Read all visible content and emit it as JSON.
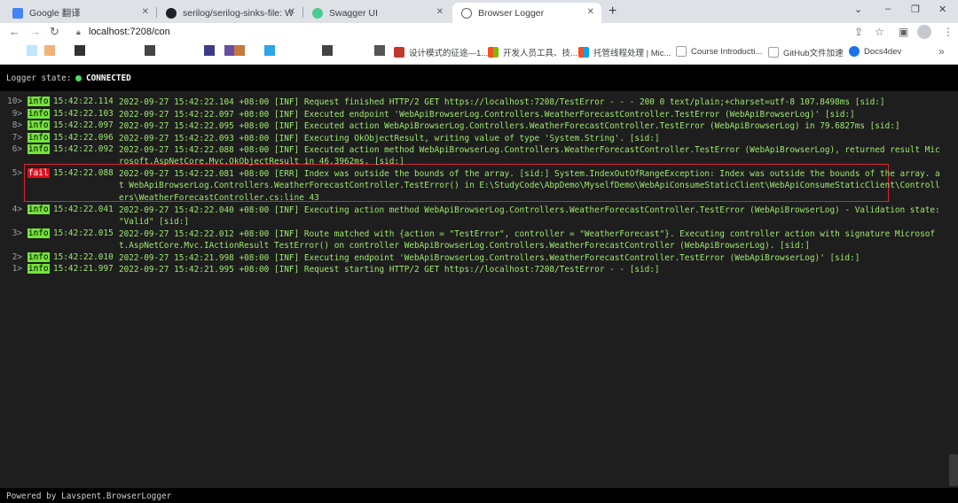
{
  "browser": {
    "tabs": [
      {
        "title": "Google 翻译",
        "icon": "google-translate-icon",
        "color": "#4285f4"
      },
      {
        "title": "serilog/serilog-sinks-file: Writ",
        "icon": "github-icon",
        "color": "#1f2328"
      },
      {
        "title": "Swagger UI",
        "icon": "swagger-icon",
        "color": "#49cc90"
      },
      {
        "title": "Browser Logger",
        "icon": "globe-icon",
        "color": "#5f6368"
      }
    ],
    "new_tab": "+",
    "window_controls": {
      "minimize": "–",
      "restore": "❐",
      "close": "✕",
      "chevron": "⌄"
    },
    "url": "localhost:7208/con",
    "bookmarks": [
      {
        "label": "设计模式的征途—1...",
        "color": "#c0392b"
      },
      {
        "label": "开发人员工具、技...",
        "color": "#f25022"
      },
      {
        "label": "托管线程处理 | Mic...",
        "color": "#f25022"
      },
      {
        "label": "Course Introducti...",
        "color": "#9aa0a6"
      },
      {
        "label": "GitHub文件加速",
        "color": "#9aa0a6"
      },
      {
        "label": "Docs4dev",
        "color": "#1a73e8"
      }
    ]
  },
  "logger": {
    "state_label": "Logger state:",
    "state_value": "CONNECTED",
    "state_color": "#4cd964",
    "entries": [
      {
        "num": "10>",
        "level": "info",
        "time": "15:42:22.114",
        "message": "2022-09-27 15:42:22.104 +08:00 [INF] Request finished HTTP/2 GET https://localhost:7208/TestError - - - 200 0 text/plain;+charset=utf-8 107.8498ms [sid:]"
      },
      {
        "num": "9>",
        "level": "info",
        "time": "15:42:22.103",
        "message": "2022-09-27 15:42:22.097 +08:00 [INF] Executed endpoint 'WebApiBrowserLog.Controllers.WeatherForecastController.TestError (WebApiBrowserLog)' [sid:]"
      },
      {
        "num": "8>",
        "level": "info",
        "time": "15:42:22.097",
        "message": "2022-09-27 15:42:22.095 +08:00 [INF] Executed action WebApiBrowserLog.Controllers.WeatherForecastController.TestError (WebApiBrowserLog) in 79.6827ms [sid:]"
      },
      {
        "num": "7>",
        "level": "info",
        "time": "15:42:22.096",
        "message": "2022-09-27 15:42:22.093 +08:00 [INF] Executing OkObjectResult, writing value of type 'System.String'. [sid:]"
      },
      {
        "num": "6>",
        "level": "info",
        "time": "15:42:22.092",
        "message": "2022-09-27 15:42:22.088 +08:00 [INF] Executed action method WebApiBrowserLog.Controllers.WeatherForecastController.TestError (WebApiBrowserLog), returned result Microsoft.AspNetCore.Mvc.OkObjectResult in 46.3962ms. [sid:]"
      },
      {
        "num": "5>",
        "level": "fail",
        "time": "15:42:22.088",
        "message": "2022-09-27 15:42:22.081 +08:00 [ERR] Index was outside the bounds of the array. [sid:] System.IndexOutOfRangeException: Index was outside the bounds of the array. at WebApiBrowserLog.Controllers.WeatherForecastController.TestError() in E:\\StudyCode\\AbpDemo\\MyselfDemo\\WebApiConsumeStaticClient\\WebApiConsumeStaticClient\\Controllers\\WeatherForecastController.cs:line 43"
      },
      {
        "num": "4>",
        "level": "info",
        "time": "15:42:22.041",
        "message": "2022-09-27 15:42:22.040 +08:00 [INF] Executing action method WebApiBrowserLog.Controllers.WeatherForecastController.TestError (WebApiBrowserLog) - Validation state: \"Valid\" [sid:]"
      },
      {
        "num": "3>",
        "level": "info",
        "time": "15:42:22.015",
        "message": "2022-09-27 15:42:22.012 +08:00 [INF] Route matched with {action = \"TestError\", controller = \"WeatherForecast\"}. Executing controller action with signature Microsoft.AspNetCore.Mvc.IActionResult TestError() on controller WebApiBrowserLog.Controllers.WeatherForecastController (WebApiBrowserLog). [sid:]"
      },
      {
        "num": "2>",
        "level": "info",
        "time": "15:42:22.010",
        "message": "2022-09-27 15:42:21.998 +08:00 [INF] Executing endpoint 'WebApiBrowserLog.Controllers.WeatherForecastController.TestError (WebApiBrowserLog)' [sid:]"
      },
      {
        "num": "1>",
        "level": "info",
        "time": "15:42:21.997",
        "message": "2022-09-27 15:42:21.995 +08:00 [INF] Request starting HTTP/2 GET https://localhost:7208/TestError - - [sid:]"
      }
    ],
    "footer": "Powered by Lavspent.BrowserLogger"
  }
}
